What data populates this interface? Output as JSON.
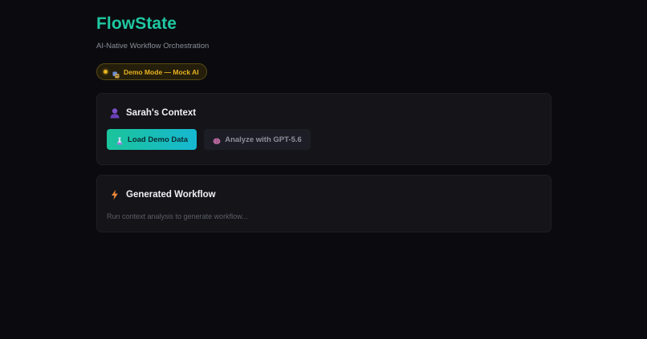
{
  "app": {
    "title": "FlowState",
    "subtitle": "AI-Native Workflow Orchestration"
  },
  "mode_badge": {
    "label": "Demo Mode — Mock AI",
    "icon": "theater-masks-icon",
    "color": "#e9b320"
  },
  "context_card": {
    "title": "Sarah's Context",
    "icon": "person-icon",
    "buttons": {
      "load_demo": {
        "label": "Load Demo Data",
        "icon": "flask-icon"
      },
      "analyze": {
        "label": "Analyze with GPT-5.6",
        "icon": "brain-icon"
      }
    }
  },
  "workflow_card": {
    "title": "Generated Workflow",
    "icon": "lightning-icon",
    "placeholder": "Run context analysis to generate workflow..."
  },
  "colors": {
    "accent": "#1fc8a2",
    "background": "#0b0b0f",
    "card": "#141419",
    "warning": "#e9b320"
  }
}
